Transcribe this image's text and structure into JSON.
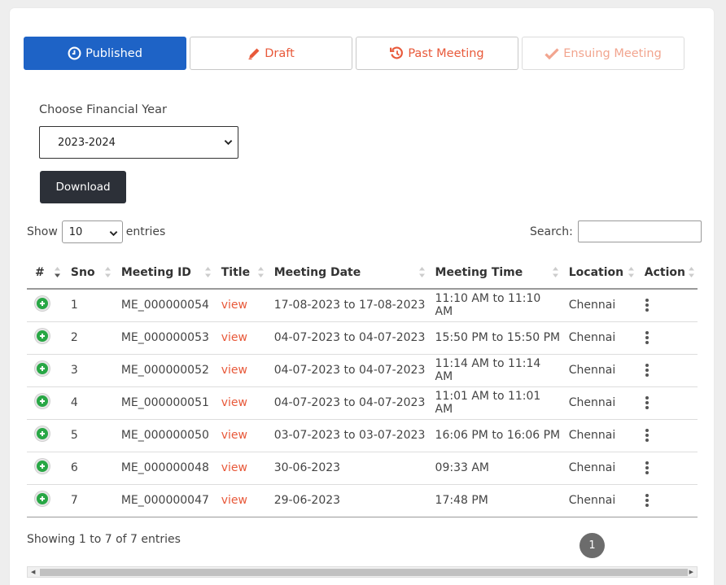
{
  "tabs": [
    {
      "label": "Published",
      "icon": "clock-icon",
      "active": true
    },
    {
      "label": "Draft",
      "icon": "pencil-icon"
    },
    {
      "label": "Past Meeting",
      "icon": "history-icon"
    },
    {
      "label": "Ensuing Meeting",
      "icon": "check-icon"
    }
  ],
  "financial_year": {
    "label": "Choose Financial Year",
    "value": "2023-2024"
  },
  "download_label": "Download",
  "length_menu": {
    "show": "Show",
    "value": "10",
    "entries": "entries"
  },
  "search": {
    "label": "Search:",
    "value": ""
  },
  "table": {
    "headers": [
      "#",
      "Sno",
      "Meeting ID",
      "Title",
      "Meeting Date",
      "Meeting Time",
      "Location",
      "Action"
    ],
    "rows": [
      {
        "sno": "1",
        "id": "ME_000000054",
        "title": "view",
        "date": "17-08-2023 to 17-08-2023",
        "time": "11:10 AM to 11:10 AM",
        "location": "Chennai"
      },
      {
        "sno": "2",
        "id": "ME_000000053",
        "title": "view",
        "date": "04-07-2023 to 04-07-2023",
        "time": "15:50 PM to 15:50 PM",
        "location": "Chennai"
      },
      {
        "sno": "3",
        "id": "ME_000000052",
        "title": "view",
        "date": "04-07-2023 to 04-07-2023",
        "time": "11:14 AM to 11:14 AM",
        "location": "Chennai"
      },
      {
        "sno": "4",
        "id": "ME_000000051",
        "title": "view",
        "date": "04-07-2023 to 04-07-2023",
        "time": "11:01 AM to 11:01 AM",
        "location": "Chennai"
      },
      {
        "sno": "5",
        "id": "ME_000000050",
        "title": "view",
        "date": "03-07-2023 to 03-07-2023",
        "time": "16:06 PM to 16:06 PM",
        "location": "Chennai"
      },
      {
        "sno": "6",
        "id": "ME_000000048",
        "title": "view",
        "date": "30-06-2023",
        "time": "09:33 AM",
        "location": "Chennai"
      },
      {
        "sno": "7",
        "id": "ME_000000047",
        "title": "view",
        "date": "29-06-2023",
        "time": "17:48 PM",
        "location": "Chennai"
      }
    ]
  },
  "info": "Showing 1 to 7 of 7 entries",
  "pagination": {
    "current": "1"
  },
  "colors": {
    "primary": "#1e63c6",
    "accent": "#e8593a",
    "success": "#28a745",
    "dark": "#2c3038"
  }
}
